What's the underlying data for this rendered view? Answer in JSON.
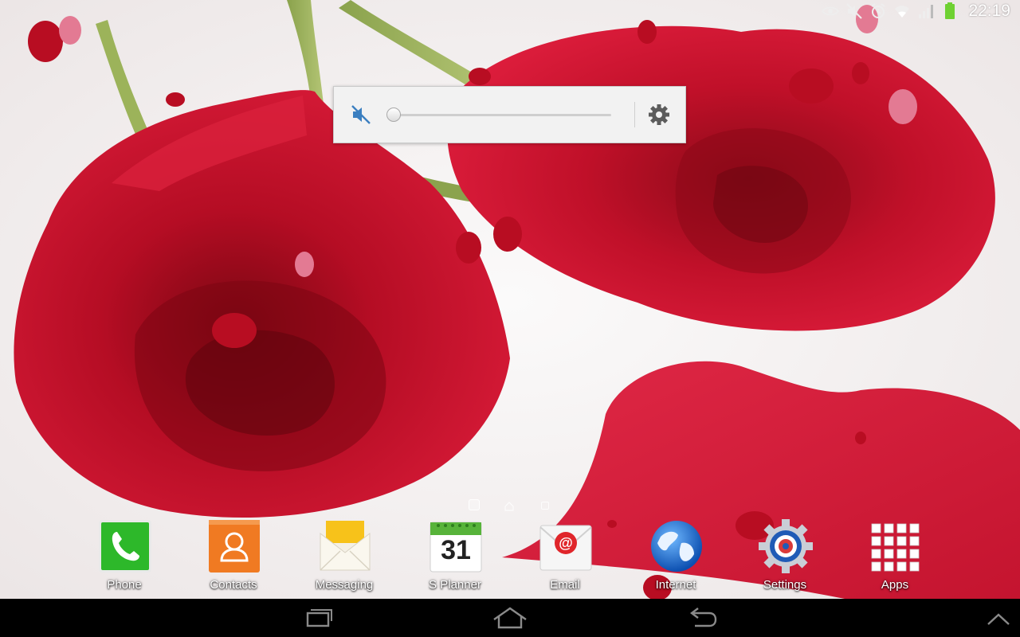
{
  "status_bar": {
    "time": "22:19",
    "icons": [
      "eye-icon",
      "mute-icon",
      "alarm-icon",
      "wifi-icon",
      "signal-icon",
      "battery-icon"
    ],
    "battery_color": "#6fd132"
  },
  "volume_panel": {
    "muted": true,
    "level": 0,
    "icons": [
      "speaker-mute-icon",
      "gear-icon"
    ],
    "accent": "#3b7fc0"
  },
  "home": {
    "pages": [
      "page",
      "home",
      "page"
    ],
    "current_page": 0
  },
  "dock": {
    "apps": [
      {
        "label": "Phone",
        "icon": "phone-icon",
        "color": "#2db82a"
      },
      {
        "label": "Contacts",
        "icon": "contacts-icon",
        "color": "#f07a22"
      },
      {
        "label": "Messaging",
        "icon": "messaging-icon",
        "color": "#f7c21a"
      },
      {
        "label": "S Planner",
        "icon": "calendar-icon",
        "day": "31",
        "color": "#57b33a"
      },
      {
        "label": "Email",
        "icon": "email-icon",
        "color": "#e0262b"
      },
      {
        "label": "Internet",
        "icon": "globe-icon",
        "color": "#1f6fd2"
      },
      {
        "label": "Settings",
        "icon": "settings-gear-icon",
        "color": "#3b7fc0"
      },
      {
        "label": "Apps",
        "icon": "apps-grid-icon",
        "color": "#d93a3a"
      }
    ]
  },
  "nav_bar": {
    "buttons": [
      "recent-apps-icon",
      "home-icon",
      "back-icon",
      "menu-up-icon"
    ]
  },
  "wallpaper": {
    "subject": "red-roses",
    "colors": {
      "rose": "#c4102a",
      "heart": "#d62240",
      "background": "#f4f1f1"
    }
  }
}
